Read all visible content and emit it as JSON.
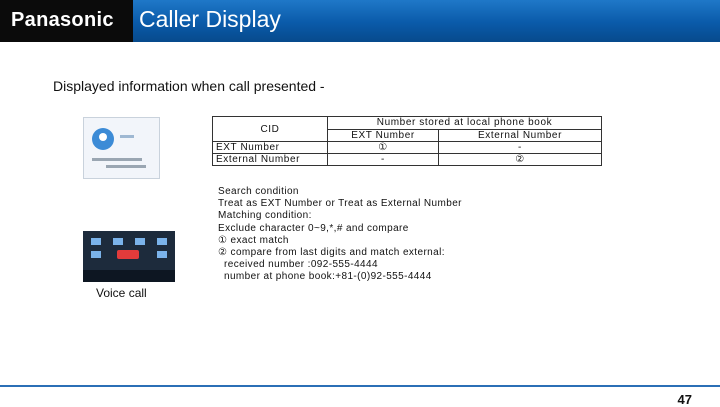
{
  "header": {
    "logo": "Panasonic",
    "title": "Caller Display",
    "accent": "#0a5aa9"
  },
  "subtitle": "Displayed information when call presented -",
  "table": {
    "cid_label": "CID",
    "book_header": "Number stored at local phone book",
    "col_ext": "EXT Number",
    "col_external": "External Number",
    "row1": {
      "label": "EXT Number",
      "ext": "①",
      "external": "-"
    },
    "row2": {
      "label": "External Number",
      "ext": "-",
      "external": "②"
    }
  },
  "notes": [
    "Search condition",
    "Treat as EXT Number or Treat as External Number",
    "Matching condition:",
    "Exclude character 0~9,*,# and compare",
    "① exact match",
    "② compare from last digits and match external:",
    "received number :092-555-4444",
    "number at phone book:+81-(0)92-555-4444"
  ],
  "voice_call": "Voice call",
  "page_number": "47"
}
